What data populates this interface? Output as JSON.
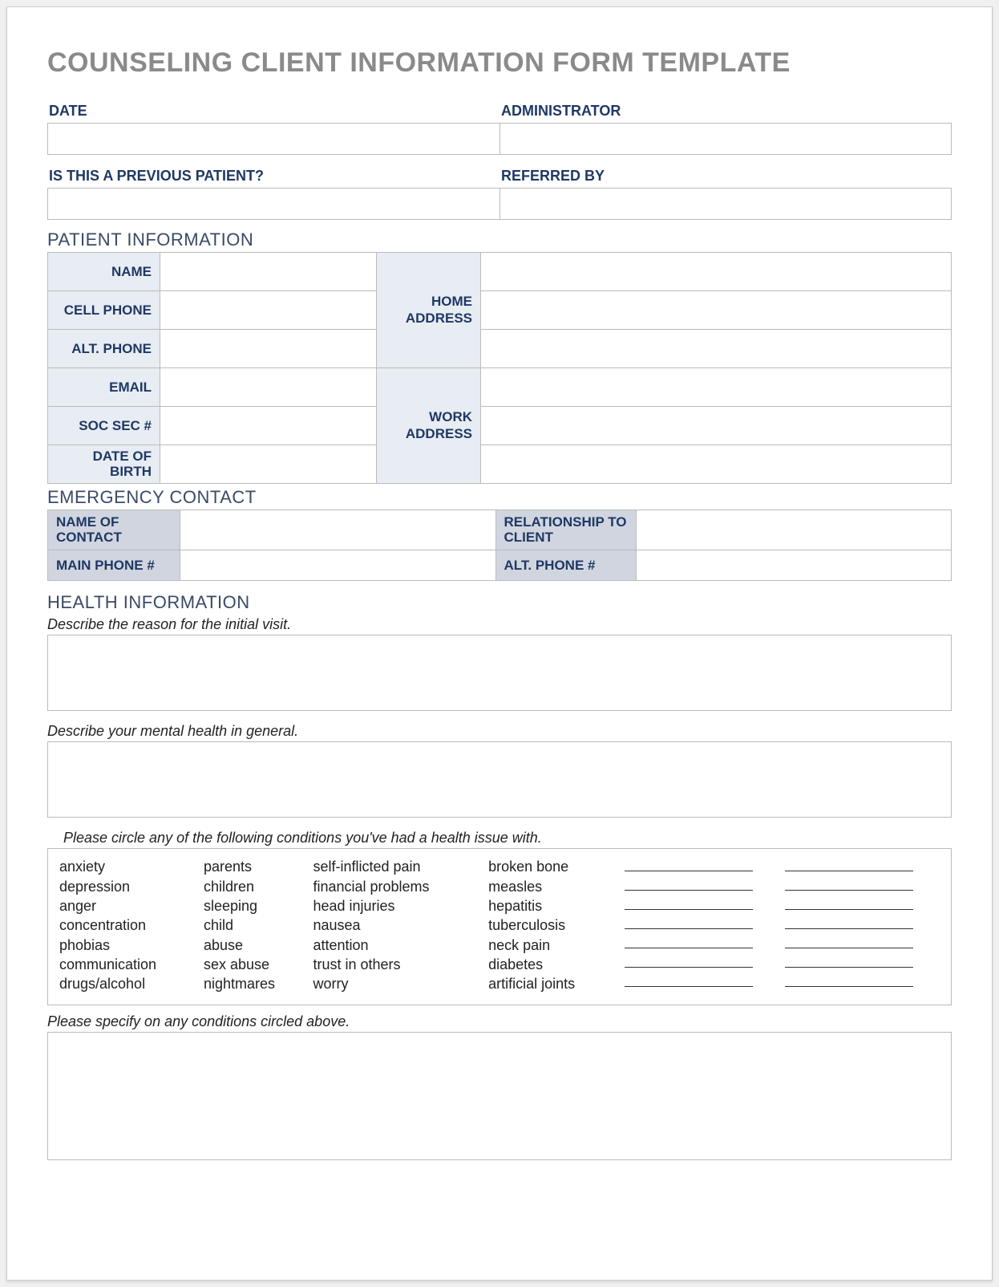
{
  "title": "COUNSELING CLIENT INFORMATION FORM TEMPLATE",
  "top": {
    "date_label": "DATE",
    "admin_label": "ADMINISTRATOR",
    "prev_patient_label": "IS THIS A PREVIOUS PATIENT?",
    "referred_label": "REFERRED BY",
    "date_value": "",
    "admin_value": "",
    "prev_patient_value": "",
    "referred_value": ""
  },
  "patient": {
    "section": "PATIENT INFORMATION",
    "name": "NAME",
    "cell": "CELL PHONE",
    "alt": "ALT. PHONE",
    "email": "EMAIL",
    "ssn": "SOC SEC #",
    "dob": "DATE OF BIRTH",
    "home": "HOME ADDRESS",
    "work": "WORK ADDRESS"
  },
  "emergency": {
    "section": "EMERGENCY CONTACT",
    "name": "NAME OF CONTACT",
    "rel": "RELATIONSHIP TO CLIENT",
    "main": "MAIN PHONE #",
    "alt": "ALT. PHONE #"
  },
  "health": {
    "section": "HEALTH INFORMATION",
    "instr1": "Describe the reason for the initial visit.",
    "instr2": "Describe your mental health in general.",
    "instr3": "Please circle any of the following conditions you've had a health issue with.",
    "instr4": "Please specify on any conditions circled above."
  },
  "conditions": {
    "col1": [
      "anxiety",
      "depression",
      "anger",
      "concentration",
      "phobias",
      "communication",
      "drugs/alcohol"
    ],
    "col2": [
      "parents",
      "children",
      "sleeping",
      "child",
      "abuse",
      "sex abuse",
      "nightmares"
    ],
    "col3": [
      "self-inflicted pain",
      "financial problems",
      "head injuries",
      "nausea",
      "attention",
      "trust in others",
      "worry"
    ],
    "col4": [
      "broken bone",
      "measles",
      "hepatitis",
      "tuberculosis",
      "neck pain",
      "diabetes",
      "artificial joints"
    ]
  }
}
